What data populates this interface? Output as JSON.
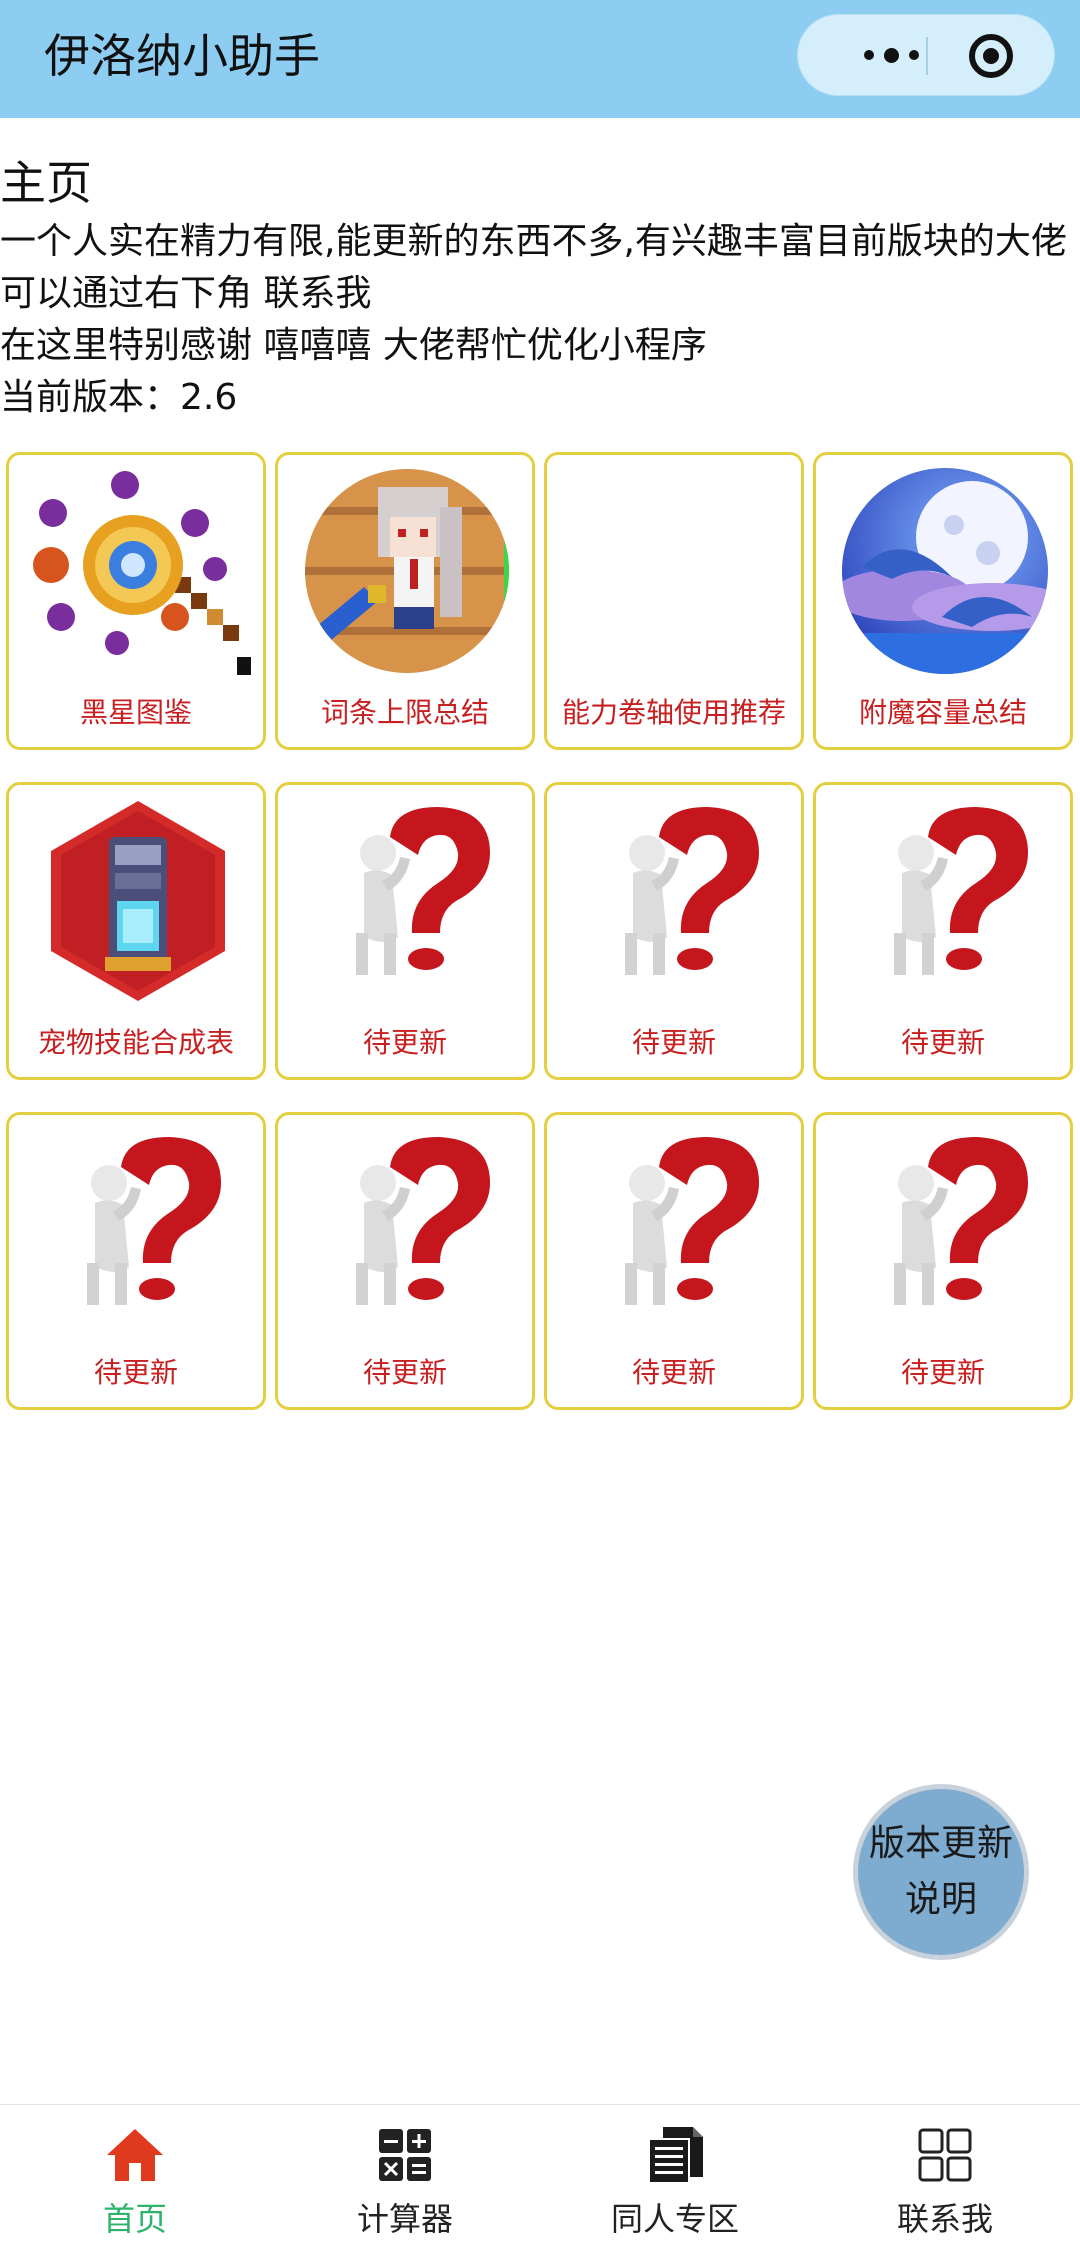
{
  "navbar": {
    "title": "伊洛纳小助手",
    "more_icon": "more-dots-icon",
    "close_icon": "target-circle-icon"
  },
  "intro": {
    "heading": "主页",
    "line1": "一个人实在精力有限,能更新的东西不多,有兴趣丰富目前版块的大佬",
    "line2": "可以通过右下角 联系我",
    "line3": "在这里特别感谢 嘻嘻嘻 大佬帮忙优化小程序",
    "line4": "当前版本：2.6"
  },
  "cards": [
    {
      "label": "黑星图鉴",
      "icon": "staff-pixel-icon"
    },
    {
      "label": "词条上限总结",
      "icon": "character-avatar-icon"
    },
    {
      "label": "能力卷轴使用推荐",
      "icon": "blank-image"
    },
    {
      "label": "附魔容量总结",
      "icon": "dolphin-moon-icon"
    },
    {
      "label": "宠物技能合成表",
      "icon": "pet-machine-hex-icon"
    },
    {
      "label": "待更新",
      "icon": "question-mark-figure-icon"
    },
    {
      "label": "待更新",
      "icon": "question-mark-figure-icon"
    },
    {
      "label": "待更新",
      "icon": "question-mark-figure-icon"
    },
    {
      "label": "待更新",
      "icon": "question-mark-figure-icon"
    },
    {
      "label": "待更新",
      "icon": "question-mark-figure-icon"
    },
    {
      "label": "待更新",
      "icon": "question-mark-figure-icon"
    },
    {
      "label": "待更新",
      "icon": "question-mark-figure-icon"
    }
  ],
  "fab": {
    "line1": "版本更新",
    "line2": "说明"
  },
  "tabbar": {
    "active_color": "#2db36b",
    "tabs": [
      {
        "label": "首页",
        "icon": "home-icon"
      },
      {
        "label": "计算器",
        "icon": "calculator-icon"
      },
      {
        "label": "同人专区",
        "icon": "document-stack-icon"
      },
      {
        "label": "联系我",
        "icon": "grid-four-icon"
      }
    ]
  }
}
